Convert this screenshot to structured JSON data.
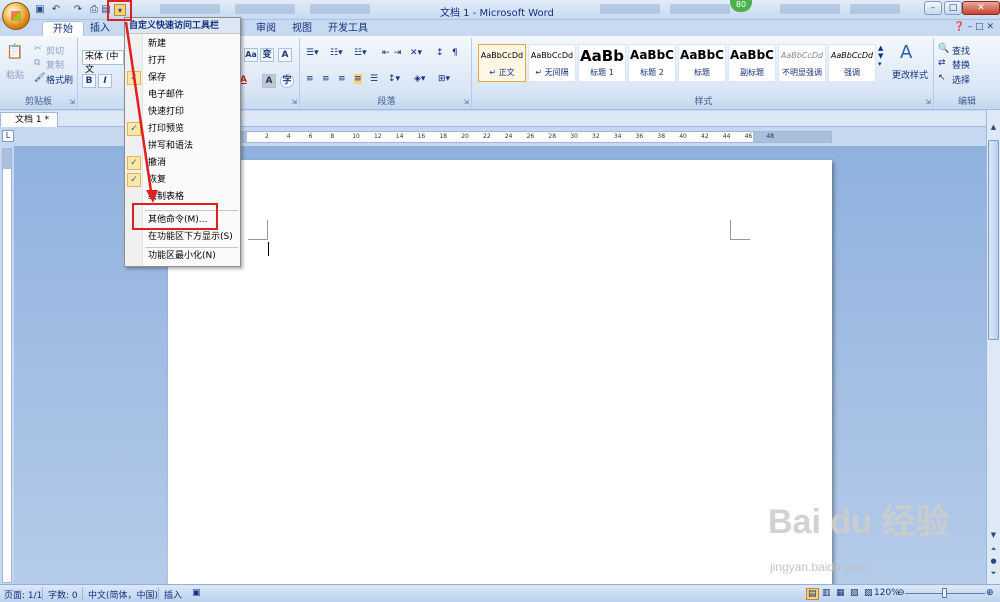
{
  "window": {
    "title": "文档 1 - Microsoft Word",
    "badge": "80",
    "minimize": "–",
    "restore": "□",
    "close": "✕"
  },
  "tabs": [
    {
      "label": "开始"
    },
    {
      "label": "插入"
    },
    {
      "label": "审阅"
    },
    {
      "label": "视图"
    },
    {
      "label": "开发工具"
    }
  ],
  "ribbon": {
    "clipboard": {
      "label": "剪贴板",
      "paste": "粘贴",
      "cut": "剪切",
      "copy": "复制",
      "format_painter": "格式刷"
    },
    "font": {
      "name_field": "宋体 (中文",
      "bold": "B",
      "italic": "I",
      "a_btn": "A",
      "aa_btn": "Aa"
    },
    "paragraph": {
      "label": "段落"
    },
    "styles": {
      "label": "样式",
      "cards": [
        {
          "sample": "AaBbCcDd",
          "name": "↵ 正文"
        },
        {
          "sample": "AaBbCcDd",
          "name": "↵ 无间隔"
        },
        {
          "sample": "AaBb",
          "name": "标题 1"
        },
        {
          "sample": "AaBbC",
          "name": "标题 2"
        },
        {
          "sample": "AaBbC",
          "name": "标题"
        },
        {
          "sample": "AaBbC",
          "name": "副标题"
        },
        {
          "sample": "AaBbCcDd",
          "name": "不明显强调"
        },
        {
          "sample": "AaBbCcDd",
          "name": "强调"
        }
      ],
      "change_styles": "更改样式"
    },
    "editing": {
      "label": "编辑",
      "find": "查找",
      "replace": "替换",
      "select": "选择"
    }
  },
  "doc_tab": {
    "label": "文档 1 *"
  },
  "ruler_ticks": [
    "2",
    "4",
    "6",
    "8",
    "10",
    "12",
    "14",
    "16",
    "18",
    "20",
    "22",
    "24",
    "26",
    "28",
    "30",
    "32",
    "34",
    "36",
    "38",
    "40",
    "42",
    "44",
    "46",
    "48"
  ],
  "qat_menu": {
    "header": "自定义快速访问工具栏",
    "items": [
      {
        "label": "新建",
        "checked": false
      },
      {
        "label": "打开",
        "checked": false
      },
      {
        "label": "保存",
        "checked": true
      },
      {
        "label": "电子邮件",
        "checked": false
      },
      {
        "label": "快速打印",
        "checked": false
      },
      {
        "label": "打印预览",
        "checked": true
      },
      {
        "label": "拼写和语法",
        "checked": false
      },
      {
        "label": "撤消",
        "checked": true
      },
      {
        "label": "恢复",
        "checked": true
      },
      {
        "label": "绘制表格",
        "checked": false
      }
    ],
    "more_commands": "其他命令(M)...",
    "show_below": "在功能区下方显示(S)",
    "minimize_ribbon": "功能区最小化(N)"
  },
  "status": {
    "page": "页面: 1/1",
    "words": "字数: 0",
    "language": "中文(简体，中国)",
    "mode": "插入",
    "zoom": "120%"
  },
  "watermark": {
    "logo": "Bai  du 经验",
    "url": "jingyan.baidu.com"
  }
}
